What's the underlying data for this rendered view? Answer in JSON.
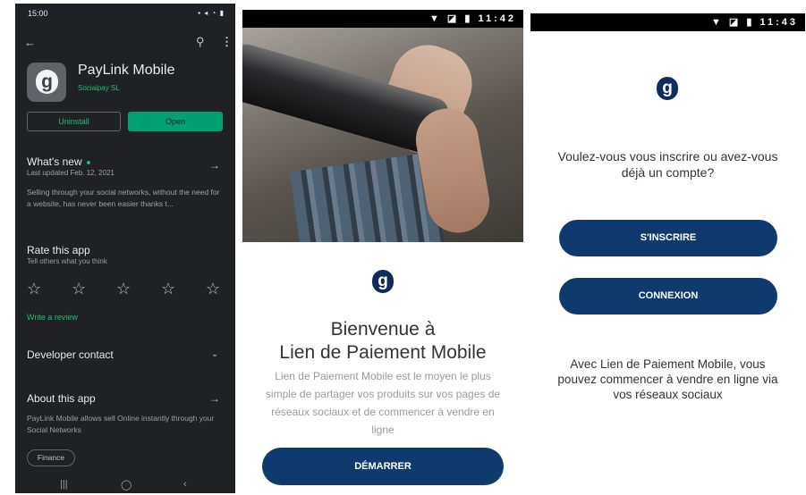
{
  "playstore": {
    "status_time": "15:00",
    "status_right": "▪ ◂ ◔ ▮",
    "app_name": "PayLink Mobile",
    "developer": "Socialpay SL",
    "uninstall_label": "Uninstall",
    "open_label": "Open",
    "whats_new": {
      "title": "What's new",
      "updated": "Last updated Feb. 12, 2021",
      "body": "Selling through your social networks, without the need for a website, has never been easier thanks t..."
    },
    "rate": {
      "title": "Rate this app",
      "subtitle": "Tell others what you think",
      "stars": 5,
      "write_review": "Write a review"
    },
    "developer_contact": "Developer contact",
    "about": {
      "title": "About this app",
      "body": "PayLink Mobile allows sell Online instantly through your Social Networks"
    },
    "category_chip": "Finance"
  },
  "welcome": {
    "status_time": "11:42",
    "title_line1": "Bienvenue à",
    "title_line2": "Lien de Paiement Mobile",
    "description": "Lien de Paiement Mobile est le moyen le plus simple de partager vos produits sur vos pages de réseaux sociaux et de commencer à vendre en ligne",
    "cta_label": "DÉMARRER"
  },
  "auth": {
    "status_time": "11:43",
    "question": "Voulez-vous vous inscrire ou avez-vous déjà un compte?",
    "signup_label": "S'INSCRIRE",
    "login_label": "CONNEXION",
    "info": "Avec Lien de Paiement Mobile, vous pouvez commencer à vendre en ligne via vos réseaux sociaux"
  },
  "colors": {
    "play_green": "#1fbf76",
    "brand_navy": "#0f3a6e"
  }
}
